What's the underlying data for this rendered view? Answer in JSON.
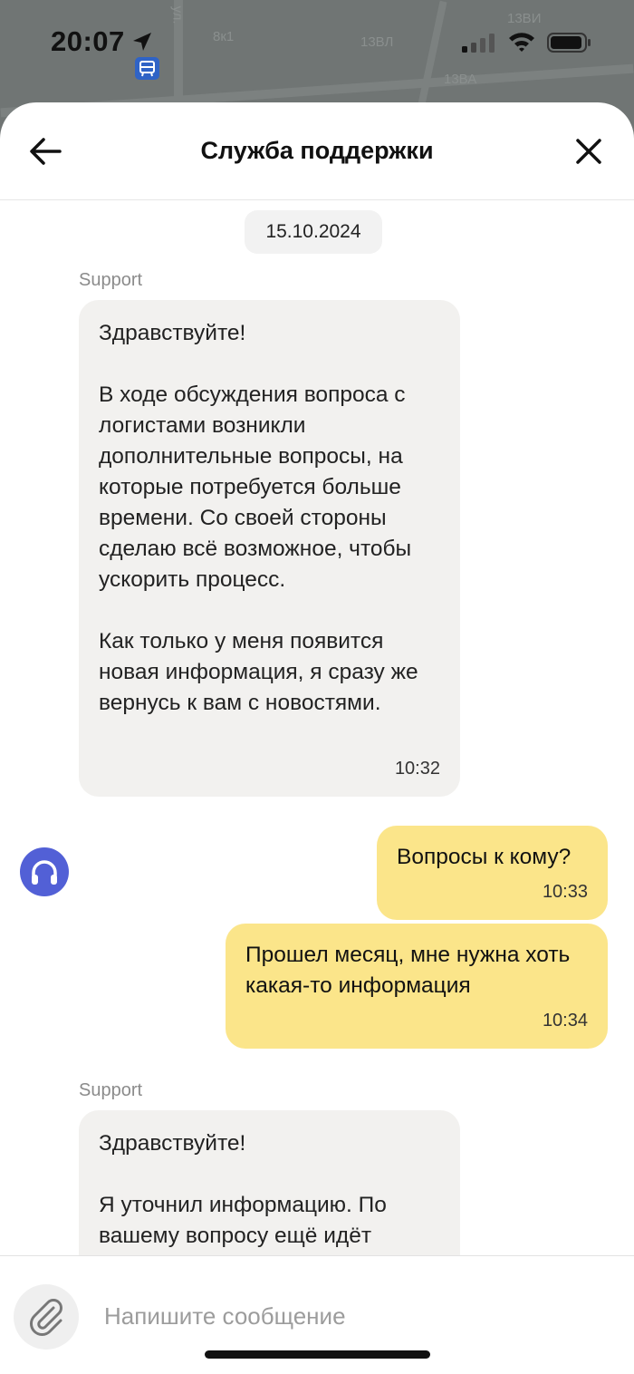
{
  "status_bar": {
    "time": "20:07",
    "map_labels": [
      "8к1",
      "13ВЛ",
      "13ВИ",
      "13ВА",
      "ул."
    ]
  },
  "header": {
    "title": "Служба поддержки"
  },
  "chat": {
    "date": "15.10.2024",
    "messages": [
      {
        "direction": "incoming",
        "sender": "Support",
        "text": "Здравствуйте!\n\nВ ходе обсуждения вопроса с логистами возникли дополнительные вопросы, на которые потребуется больше времени. Со своей стороны сделаю всё возможное, чтобы ускорить процесс.\n\nКак только у меня появится новая информация, я сразу же вернусь к вам с новостями.",
        "time": "10:32"
      },
      {
        "direction": "outgoing",
        "text": "Вопросы к кому?",
        "time": "10:33"
      },
      {
        "direction": "outgoing",
        "text": "Прошел месяц, мне нужна хоть какая-то информация",
        "time": "10:34"
      },
      {
        "direction": "incoming",
        "sender": "Support",
        "text": "Здравствуйте!\n\nЯ уточнил информацию. По вашему вопросу ещё идёт",
        "time": ""
      }
    ]
  },
  "composer": {
    "placeholder": "Напишите сообщение"
  },
  "icons": {
    "back": "arrow-left-icon",
    "close": "close-icon",
    "attach": "paperclip-icon",
    "agent_avatar": "headphones-icon"
  },
  "colors": {
    "incoming_bubble": "#f2f1ef",
    "outgoing_bubble": "#fbe58a",
    "avatar": "#5260d6"
  }
}
